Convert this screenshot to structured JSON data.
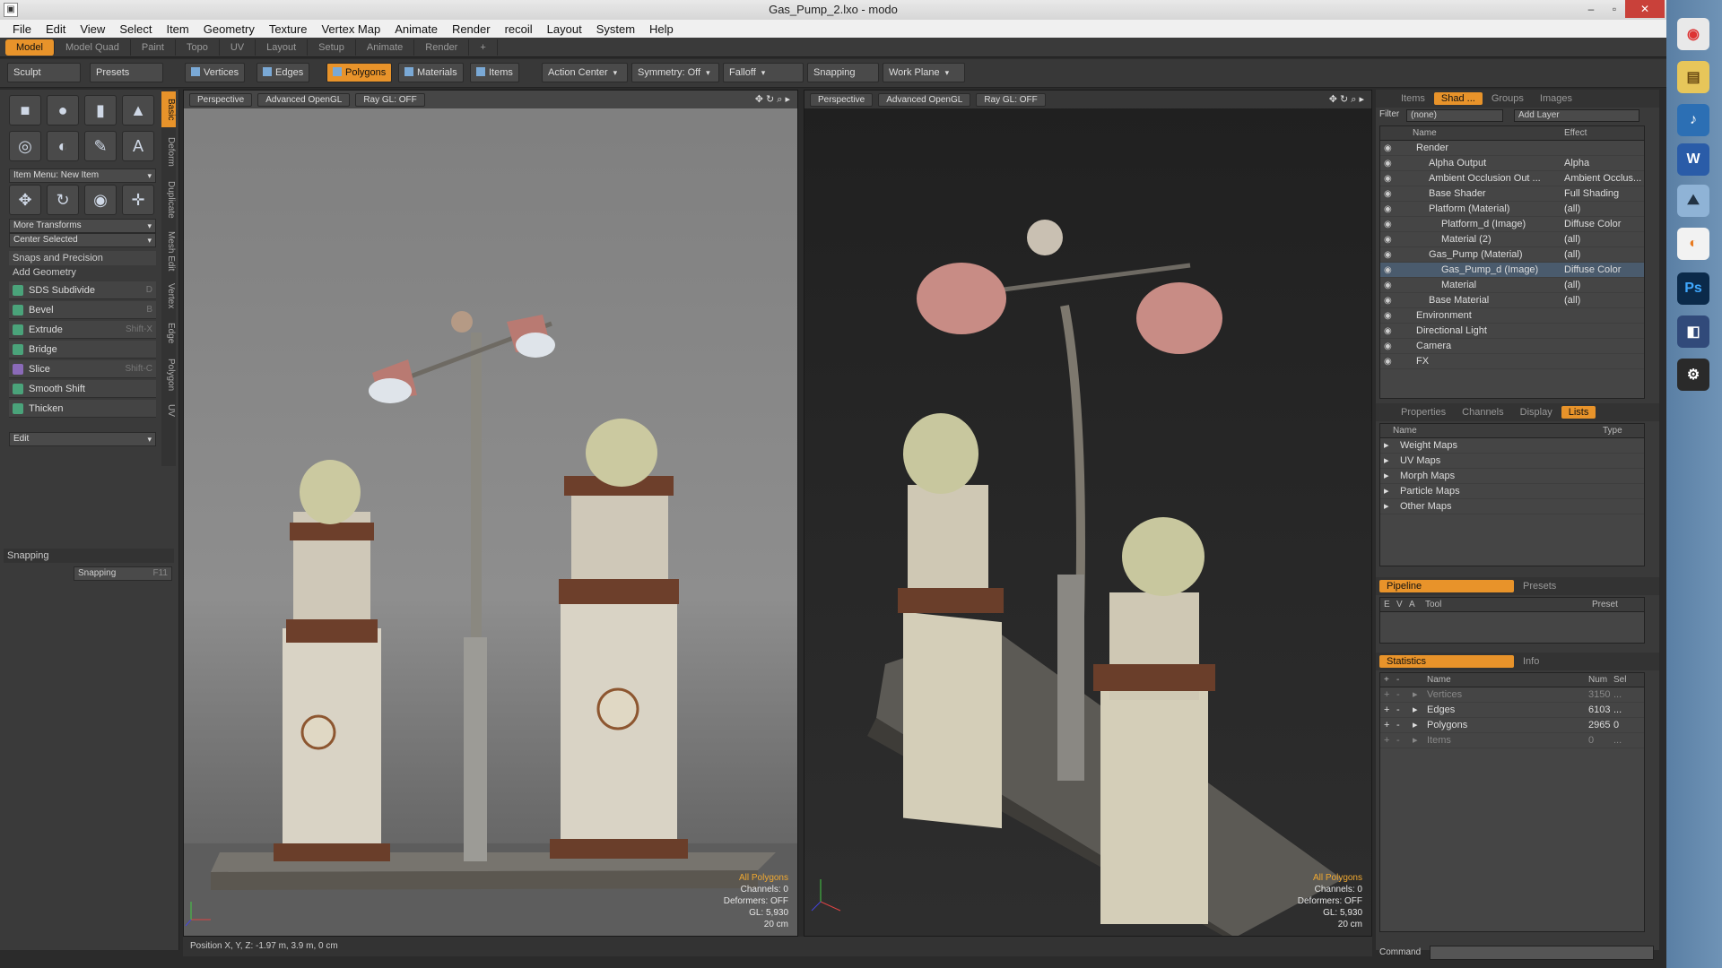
{
  "window": {
    "title": "Gas_Pump_2.lxo - modo",
    "minimize": "–",
    "maximize": "▫",
    "close": "✕"
  },
  "menu": [
    "File",
    "Edit",
    "View",
    "Select",
    "Item",
    "Geometry",
    "Texture",
    "Vertex Map",
    "Animate",
    "Render",
    "recoil",
    "Layout",
    "System",
    "Help"
  ],
  "layout_tabs": [
    "Model",
    "Model Quad",
    "Paint",
    "Topo",
    "UV",
    "Layout",
    "Setup",
    "Animate",
    "Render"
  ],
  "layout_add": "+",
  "toolbar": {
    "vertices": "Vertices",
    "edges": "Edges",
    "polygons": "Polygons",
    "materials": "Materials",
    "items": "Items",
    "action_center": "Action Center",
    "symmetry": "Symmetry: Off",
    "falloff": "Falloff",
    "snapping": "Snapping",
    "work_plane": "Work Plane"
  },
  "left": {
    "sculpt": "Sculpt",
    "presets": "Presets",
    "item_menu": "Item Menu: New Item",
    "more_transforms": "More Transforms",
    "center_selected": "Center Selected",
    "snaps_precision": "Snaps and Precision",
    "add_geometry": "Add Geometry",
    "tools": [
      {
        "label": "SDS Subdivide",
        "shortcut": "D"
      },
      {
        "label": "Bevel",
        "shortcut": "B"
      },
      {
        "label": "Extrude",
        "shortcut": "Shift-X"
      },
      {
        "label": "Bridge",
        "shortcut": ""
      },
      {
        "label": "Slice",
        "shortcut": "Shift-C"
      },
      {
        "label": "Smooth Shift",
        "shortcut": ""
      },
      {
        "label": "Thicken",
        "shortcut": ""
      }
    ],
    "edit": "Edit",
    "snapping_section": "Snapping",
    "snapping_btn": "Snapping",
    "snapping_key": "F11",
    "vtabs": [
      "Basic",
      "Deform",
      "Duplicate",
      "Mesh Edit",
      "Vertex",
      "Edge",
      "Polygon",
      "UV"
    ]
  },
  "viewport1": {
    "view": "Perspective",
    "gl": "Advanced OpenGL",
    "ray": "Ray GL: OFF",
    "stats": [
      "All Polygons",
      "Channels: 0",
      "Deformers: OFF",
      "GL: 5,930",
      "20 cm"
    ]
  },
  "viewport2": {
    "view": "Perspective",
    "gl": "Advanced OpenGL",
    "ray": "Ray GL: OFF",
    "stats": [
      "All Polygons",
      "Channels: 0",
      "Deformers: OFF",
      "GL: 5,930",
      "20 cm"
    ]
  },
  "status": "Position X, Y, Z:  -1.97 m, 3.9 m, 0 cm",
  "right": {
    "tabs1": [
      "Items",
      "Shad ...",
      "Groups",
      "Images"
    ],
    "filter_label": "Filter",
    "filter_value": "(none)",
    "add_layer": "Add Layer",
    "shader_header": {
      "name": "Name",
      "effect": "Effect"
    },
    "shader_rows": [
      {
        "name": "Render",
        "effect": "",
        "indent": 0
      },
      {
        "name": "Alpha Output",
        "effect": "Alpha",
        "indent": 1
      },
      {
        "name": "Ambient Occlusion Out ...",
        "effect": "Ambient Occlus...",
        "indent": 1
      },
      {
        "name": "Base Shader",
        "effect": "Full Shading",
        "indent": 1
      },
      {
        "name": "Platform (Material)",
        "effect": "(all)",
        "indent": 1
      },
      {
        "name": "Platform_d (Image)",
        "effect": "Diffuse Color",
        "indent": 2
      },
      {
        "name": "Material (2)",
        "effect": "(all)",
        "indent": 2
      },
      {
        "name": "Gas_Pump (Material)",
        "effect": "(all)",
        "indent": 1
      },
      {
        "name": "Gas_Pump_d (Image)",
        "effect": "Diffuse Color",
        "indent": 2,
        "selected": true
      },
      {
        "name": "Material",
        "effect": "(all)",
        "indent": 2
      },
      {
        "name": "Base Material",
        "effect": "(all)",
        "indent": 1
      },
      {
        "name": "Environment",
        "effect": "",
        "indent": 0
      },
      {
        "name": "Directional Light",
        "effect": "",
        "indent": 0
      },
      {
        "name": "Camera",
        "effect": "",
        "indent": 0
      },
      {
        "name": "FX",
        "effect": "",
        "indent": 0
      }
    ],
    "tabs2": [
      "Properties",
      "Channels",
      "Display",
      "Lists"
    ],
    "lists_header": {
      "name": "Name",
      "type": "Type"
    },
    "lists_rows": [
      "Weight Maps",
      "UV Maps",
      "Morph Maps",
      "Particle Maps",
      "Other Maps"
    ],
    "pipeline_tabs": [
      "Pipeline",
      "Presets"
    ],
    "pipeline_header": {
      "e": "E",
      "v": "V",
      "a": "A",
      "tool": "Tool",
      "preset": "Preset"
    },
    "stats_tabs": [
      "Statistics",
      "Info"
    ],
    "stats_header": {
      "name": "Name",
      "num": "Num",
      "sel": "Sel"
    },
    "stats_rows": [
      {
        "name": "Vertices",
        "num": "3150",
        "sel": "...",
        "dim": true
      },
      {
        "name": "Edges",
        "num": "6103",
        "sel": "..."
      },
      {
        "name": "Polygons",
        "num": "2965",
        "sel": "0"
      },
      {
        "name": "Items",
        "num": "0",
        "sel": "...",
        "dim": true
      }
    ],
    "command_label": "Command"
  }
}
